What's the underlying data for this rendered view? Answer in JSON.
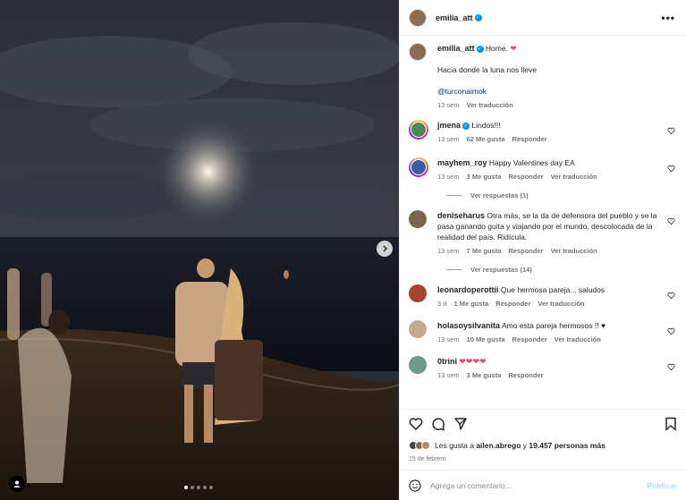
{
  "post": {
    "author": "emilia_att",
    "caption_text": "Home.",
    "caption_line2": "Hacia donde la luna nos lleve",
    "caption_mention": "@turconaimok",
    "caption_time": "13 sem",
    "caption_translate": "Ver traducción"
  },
  "comments": [
    {
      "user": "jmena",
      "verified": true,
      "text": "Lindos!!!",
      "time": "13 sem",
      "likes": "62 Me gusta",
      "reply": "Responder",
      "translate": ""
    },
    {
      "user": "mayhem_roy",
      "verified": false,
      "text": "Happy Valentines day EA",
      "time": "13 sem",
      "likes": "3 Me gusta",
      "reply": "Responder",
      "translate": "Ver traducción",
      "replies": "Ver respuestas (1)"
    },
    {
      "user": "deniseharus",
      "verified": false,
      "text": "Otra más, se la da de defensora del pueblo y se la pasa ganando guita y viajando por el mundo, descolocada de la realidad del país. Ridícula.",
      "time": "13 sem",
      "likes": "7 Me gusta",
      "reply": "Responder",
      "translate": "Ver traducción",
      "replies": "Ver respuestas (14)"
    },
    {
      "user": "leonardoperottii",
      "verified": false,
      "text": "Que hermosa pareja... saludos",
      "time": "3 d",
      "likes": "1 Me gusta",
      "reply": "Responder",
      "translate": "Ver traducción"
    },
    {
      "user": "holasoysilvanita",
      "verified": false,
      "text": "Amo esta pareja hermosos !!",
      "time": "13 sem",
      "likes": "10 Me gusta",
      "reply": "Responder",
      "translate": "Ver traducción"
    },
    {
      "user": "0trini",
      "verified": false,
      "text": "",
      "time": "13 sem",
      "likes": "3 Me gusta",
      "reply": "Responder",
      "translate": ""
    }
  ],
  "likes": {
    "prefix": "Les gusta a",
    "user": "ailen.abrego",
    "joiner": "y",
    "count": "19.457 personas más"
  },
  "date": "15 de febrero",
  "compose": {
    "placeholder": "Agrega un comentario...",
    "publish": "Publicar"
  },
  "colors": {
    "accent": "#0095f6",
    "heart": "#ed4956",
    "link": "#00376b"
  }
}
